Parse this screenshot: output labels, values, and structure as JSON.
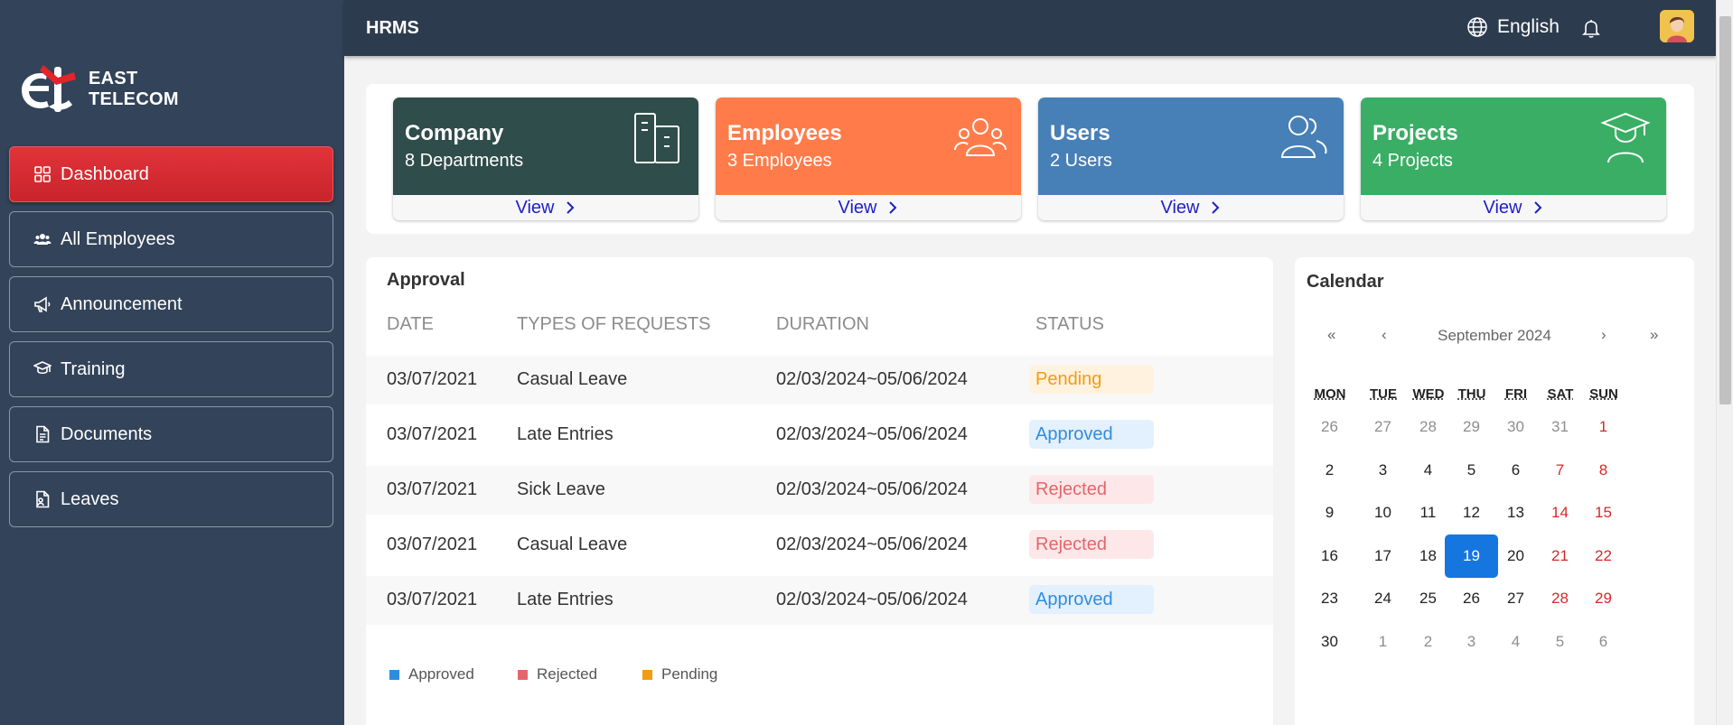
{
  "brand": {
    "line1": "EAST",
    "line2": "TELECOM"
  },
  "sidebar": {
    "items": [
      {
        "label": "Dashboard",
        "icon": "grid-icon",
        "active": true
      },
      {
        "label": "All Employees",
        "icon": "users-icon"
      },
      {
        "label": "Announcement",
        "icon": "megaphone-icon"
      },
      {
        "label": "Training",
        "icon": "training-icon"
      },
      {
        "label": "Documents",
        "icon": "document-icon"
      },
      {
        "label": "Leaves",
        "icon": "leave-icon"
      }
    ]
  },
  "header": {
    "title": "HRMS",
    "language": "English"
  },
  "cards": [
    {
      "title": "Company",
      "sub": "8 Departments",
      "view": "View",
      "color": "#2f4d4a",
      "icon": "building-icon"
    },
    {
      "title": "Employees",
      "sub": "3 Employees",
      "view": "View",
      "color": "#ff7c4a",
      "icon": "group-icon"
    },
    {
      "title": "Users",
      "sub": "2 Users",
      "view": "View",
      "color": "#4780b7",
      "icon": "user-icon"
    },
    {
      "title": "Projects",
      "sub": "4 Projects",
      "view": "View",
      "color": "#3aae65",
      "icon": "graduate-icon"
    }
  ],
  "approval": {
    "title": "Approval",
    "headers": [
      "DATE",
      "TYPES OF REQUESTS",
      "DURATION",
      "STATUS"
    ],
    "rows": [
      {
        "date": "03/07/2021",
        "type": "Casual Leave",
        "duration": "02/03/2024~05/06/2024",
        "status": "Pending"
      },
      {
        "date": "03/07/2021",
        "type": "Late Entries",
        "duration": "02/03/2024~05/06/2024",
        "status": "Approved"
      },
      {
        "date": "03/07/2021",
        "type": "Sick Leave",
        "duration": "02/03/2024~05/06/2024",
        "status": "Rejected"
      },
      {
        "date": "03/07/2021",
        "type": "Casual Leave",
        "duration": "02/03/2024~05/06/2024",
        "status": "Rejected"
      },
      {
        "date": "03/07/2021",
        "type": "Late Entries",
        "duration": "02/03/2024~05/06/2024",
        "status": "Approved"
      }
    ],
    "legend": [
      {
        "label": "Approved",
        "color": "#2f8ddf"
      },
      {
        "label": "Rejected",
        "color": "#e5656c"
      },
      {
        "label": "Pending",
        "color": "#f39c12"
      }
    ]
  },
  "calendar": {
    "title": "Calendar",
    "month": "September 2024",
    "nav": {
      "prev_year": "«",
      "prev_month": "‹",
      "next_month": "›",
      "next_year": "»"
    },
    "weekdays": [
      "MON",
      "TUE",
      "WED",
      "THU",
      "FRI",
      "SAT",
      "SUN"
    ],
    "weeks": [
      [
        "26",
        "27",
        "28",
        "29",
        "30",
        "31",
        "1"
      ],
      [
        "2",
        "3",
        "4",
        "5",
        "6",
        "7",
        "8"
      ],
      [
        "9",
        "10",
        "11",
        "12",
        "13",
        "14",
        "15"
      ],
      [
        "16",
        "17",
        "18",
        "19",
        "20",
        "21",
        "22"
      ],
      [
        "23",
        "24",
        "25",
        "26",
        "27",
        "28",
        "29"
      ],
      [
        "30",
        "1",
        "2",
        "3",
        "4",
        "5",
        "6"
      ]
    ],
    "today": "19"
  }
}
